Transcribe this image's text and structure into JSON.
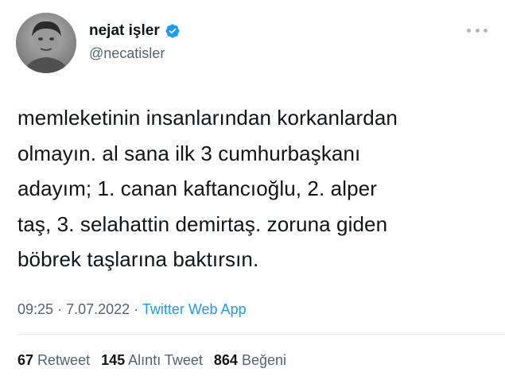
{
  "user": {
    "display_name": "nejat işler",
    "handle": "@necatisler",
    "verified": true,
    "verified_icon": "verified-badge-icon",
    "avatar_icon": "avatar-photo"
  },
  "tweet": {
    "lines": [
      "memleketinin insanlarından korkanlardan",
      "olmayın. al sana ilk 3 cumhurbaşkanı",
      "adayım; 1. canan kaftancıoğlu, 2. alper",
      "taş, 3. selahattin demirtaş. zoruna giden",
      "böbrek taşlarına baktırsın."
    ],
    "time": "09:25",
    "separator": "·",
    "date": "7.07.2022",
    "source": "Twitter Web App"
  },
  "stats": {
    "retweets_count": "67",
    "retweets_label": "Retweet",
    "quotes_count": "145",
    "quotes_label": "Alıntı Tweet",
    "likes_count": "864",
    "likes_label": "Beğeni"
  },
  "colors": {
    "accent": "#1d9bf0",
    "text": "#0f1419",
    "secondary": "#536471"
  }
}
